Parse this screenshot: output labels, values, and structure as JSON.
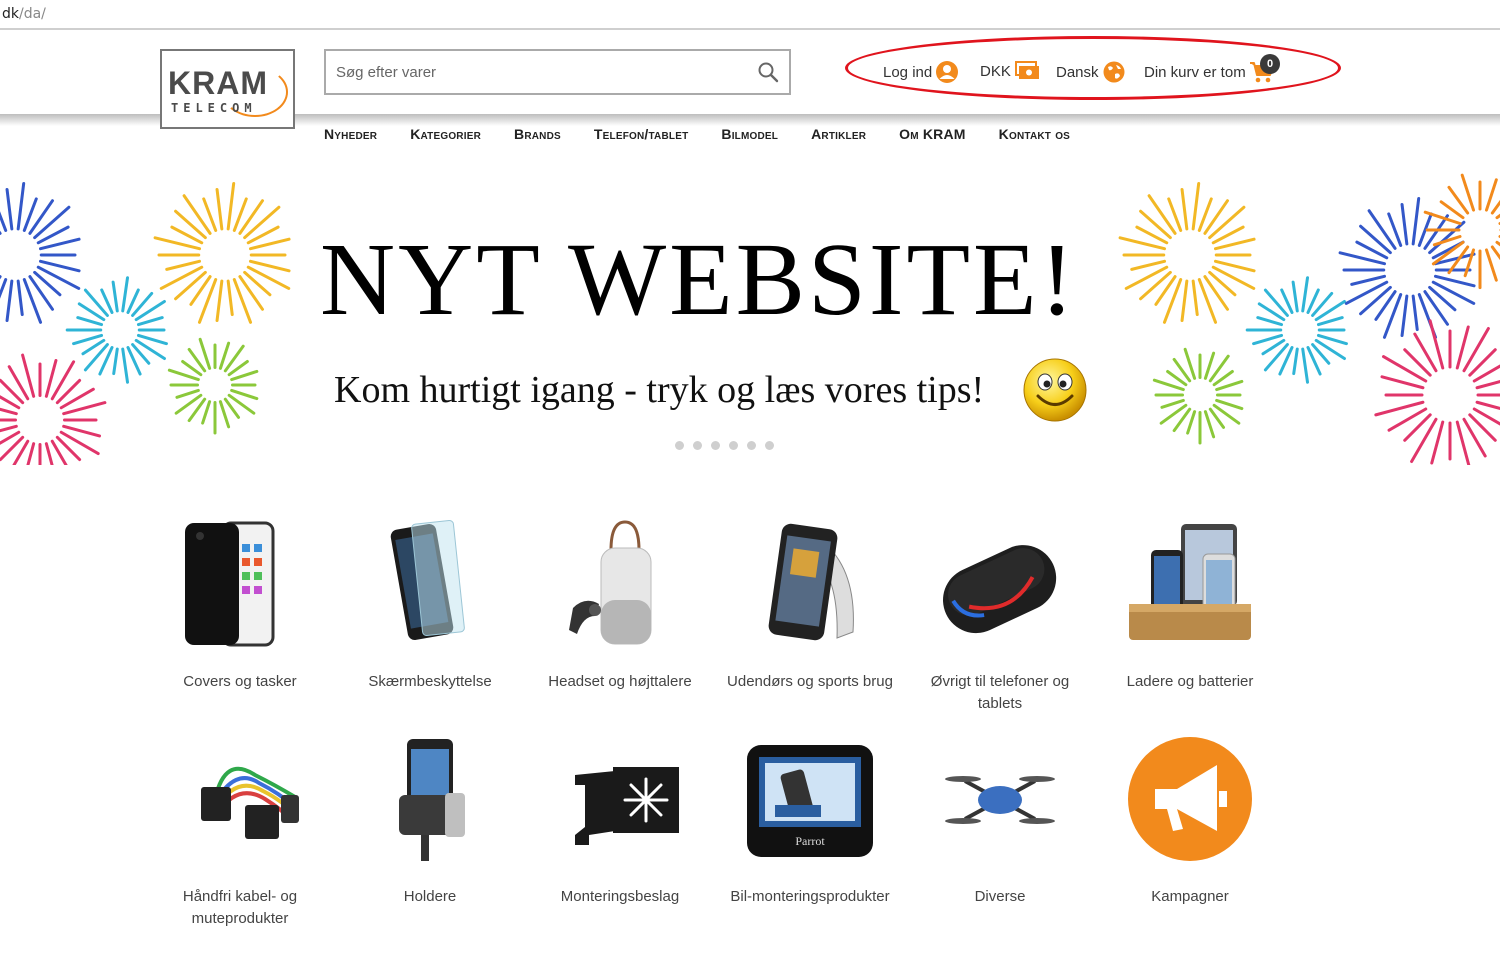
{
  "browser": {
    "url_host": "dk",
    "url_path": "/da/"
  },
  "header": {
    "logo_line1": "KRAM",
    "logo_line2": "TELECOM",
    "search_placeholder": "Søg efter varer",
    "login_label": "Log ind",
    "currency_label": "DKK",
    "language_label": "Dansk",
    "cart_label": "Din kurv er tom",
    "cart_count": "0"
  },
  "nav": [
    "Nyheder",
    "Kategorier",
    "Brands",
    "Telefon/tablet",
    "Bilmodel",
    "Artikler",
    "Om KRAM",
    "Kontakt os"
  ],
  "banner": {
    "title": "NYT WEBSITE!",
    "subtitle": "Kom hurtigt igang - tryk og læs vores tips!",
    "slide_count": 6
  },
  "categories": [
    {
      "label": "Covers og tasker"
    },
    {
      "label": "Skærmbeskyttelse"
    },
    {
      "label": "Headset og højttalere"
    },
    {
      "label": "Udendørs og sports brug"
    },
    {
      "label": "Øvrigt til telefoner og tablets"
    },
    {
      "label": "Ladere og batterier"
    },
    {
      "label": "Håndfri kabel- og muteprodukter"
    },
    {
      "label": "Holdere"
    },
    {
      "label": "Monteringsbeslag"
    },
    {
      "label": "Bil-monteringsprodukter"
    },
    {
      "label": "Diverse"
    },
    {
      "label": "Kampagner"
    }
  ],
  "colors": {
    "accent": "#f28a1c",
    "highlight_oval": "#e0141d"
  }
}
